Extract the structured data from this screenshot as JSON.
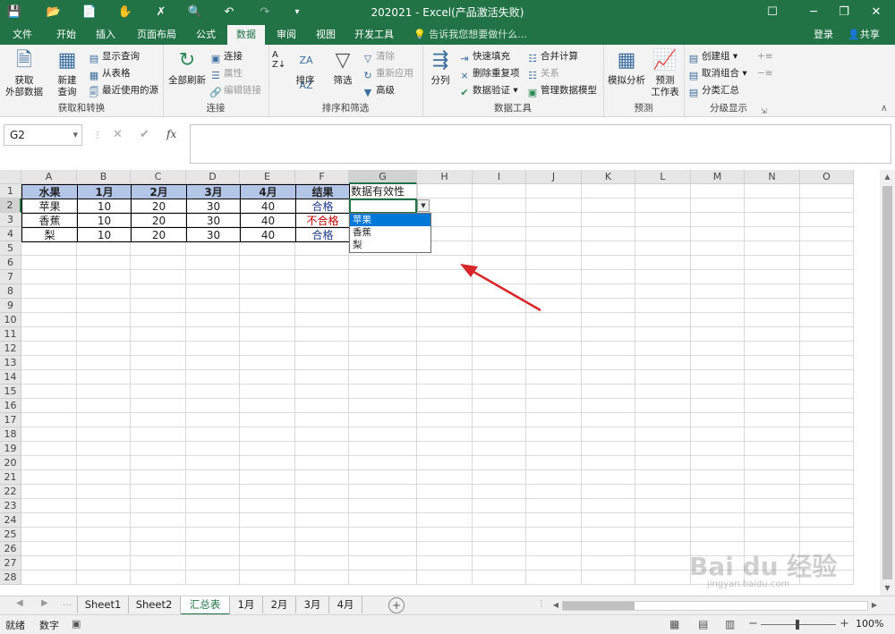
{
  "window": {
    "title": "202021 - Excel(产品激活失败)"
  },
  "tabs": [
    "文件",
    "开始",
    "插入",
    "页面布局",
    "公式",
    "数据",
    "审阅",
    "视图",
    "开发工具"
  ],
  "active_tab": "数据",
  "tell_me": "告诉我您想要做什么...",
  "account": {
    "signin": "登录",
    "share": "共享"
  },
  "ribbon": {
    "get_external": "获取\n外部数据",
    "new_query": "新建\n查询",
    "show_queries": "显示查询",
    "from_table": "从表格",
    "recent_sources": "最近使用的源",
    "group_get_transform": "获取和转换",
    "refresh_all": "全部刷新",
    "connections": "连接",
    "properties": "属性",
    "edit_links": "编辑链接",
    "group_connections": "连接",
    "sort": "排序",
    "filter": "筛选",
    "clear": "清除",
    "reapply": "重新应用",
    "advanced": "高级",
    "group_sort_filter": "排序和筛选",
    "text_to_columns": "分列",
    "flash_fill": "快速填充",
    "remove_duplicates": "删除重复项",
    "data_validation": "数据验证",
    "consolidate": "合并计算",
    "relationships": "关系",
    "manage_model": "管理数据模型",
    "group_data_tools": "数据工具",
    "what_if": "模拟分析",
    "forecast_sheet": "预测\n工作表",
    "group_forecast": "预测",
    "group_btn": "创建组",
    "ungroup_btn": "取消组合",
    "subtotal": "分类汇总",
    "group_outline": "分级显示"
  },
  "formula_bar": {
    "name_box": "G2",
    "fx": "fx",
    "formula": ""
  },
  "columns": [
    "A",
    "B",
    "C",
    "D",
    "E",
    "F",
    "G",
    "H",
    "I",
    "J",
    "K",
    "L",
    "M",
    "N",
    "O"
  ],
  "row_numbers": [
    "1",
    "2",
    "3",
    "4",
    "5",
    "6",
    "7",
    "8",
    "9",
    "10",
    "11",
    "12",
    "13",
    "14",
    "15",
    "16",
    "17",
    "18",
    "19",
    "20",
    "21",
    "22",
    "23",
    "24",
    "25",
    "26",
    "27",
    "28"
  ],
  "cells": {
    "header": [
      "水果",
      "1月",
      "2月",
      "3月",
      "4月",
      "结果",
      "数据有效性"
    ],
    "rows": [
      [
        "苹果",
        "10",
        "20",
        "30",
        "40",
        "合格"
      ],
      [
        "香蕉",
        "10",
        "20",
        "30",
        "40",
        "不合格"
      ],
      [
        "梨",
        "10",
        "20",
        "30",
        "40",
        "合格"
      ]
    ]
  },
  "result_colors": {
    "合格": "#1f3c88",
    "不合格": "#c00000"
  },
  "validation_dropdown": {
    "items": [
      "苹果",
      "香蕉",
      "梨"
    ],
    "selected_index": 0
  },
  "sheet_tabs": [
    "Sheet1",
    "Sheet2",
    "汇总表",
    "1月",
    "2月",
    "3月",
    "4月"
  ],
  "active_sheet": "汇总表",
  "status": {
    "ready": "就绪",
    "num": "数字",
    "zoom": "100%"
  },
  "watermark": {
    "brand": "Bai du 经验",
    "url": "jingyan.baidu.com"
  },
  "colors": {
    "excel_green": "#217346",
    "header_fill": "#b4c6e7",
    "selection": "#0078d7",
    "arrow": "#d9262b"
  }
}
